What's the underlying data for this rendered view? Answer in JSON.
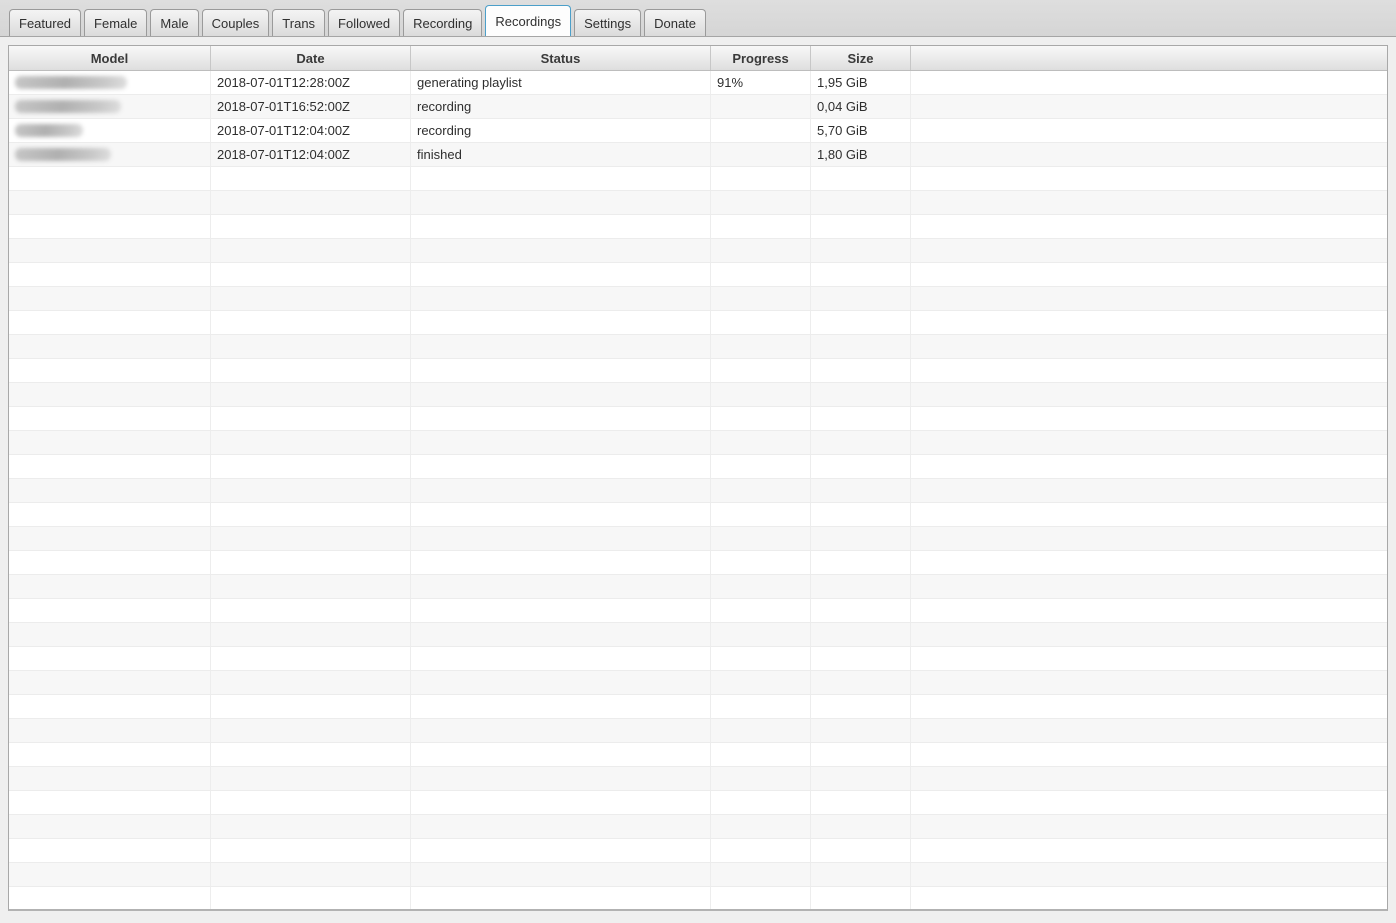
{
  "tabbar": {
    "tabs": [
      {
        "label": "Featured",
        "active": false
      },
      {
        "label": "Female",
        "active": false
      },
      {
        "label": "Male",
        "active": false
      },
      {
        "label": "Couples",
        "active": false
      },
      {
        "label": "Trans",
        "active": false
      },
      {
        "label": "Followed",
        "active": false
      },
      {
        "label": "Recording",
        "active": false
      },
      {
        "label": "Recordings",
        "active": true
      },
      {
        "label": "Settings",
        "active": false
      },
      {
        "label": "Donate",
        "active": false
      }
    ]
  },
  "recordings_table": {
    "columns": [
      {
        "label": "Model"
      },
      {
        "label": "Date"
      },
      {
        "label": "Status"
      },
      {
        "label": "Progress"
      },
      {
        "label": "Size"
      },
      {
        "label": ""
      }
    ],
    "rows": [
      {
        "model_redacted": true,
        "model_blur_width": 112,
        "date": "2018-07-01T12:28:00Z",
        "status": "generating playlist",
        "progress": "91%",
        "size": "1,95 GiB"
      },
      {
        "model_redacted": true,
        "model_blur_width": 106,
        "date": "2018-07-01T16:52:00Z",
        "status": "recording",
        "progress": "",
        "size": "0,04 GiB"
      },
      {
        "model_redacted": true,
        "model_blur_width": 68,
        "date": "2018-07-01T12:04:00Z",
        "status": "recording",
        "progress": "",
        "size": "5,70 GiB"
      },
      {
        "model_redacted": true,
        "model_blur_width": 96,
        "date": "2018-07-01T12:04:00Z",
        "status": "finished",
        "progress": "",
        "size": "1,80 GiB"
      }
    ],
    "empty_row_count": 31
  },
  "colors": {
    "active_tab_border": "#4c9fc9",
    "row_stripe": "#f7f7f7",
    "window_background": "#efefef"
  }
}
